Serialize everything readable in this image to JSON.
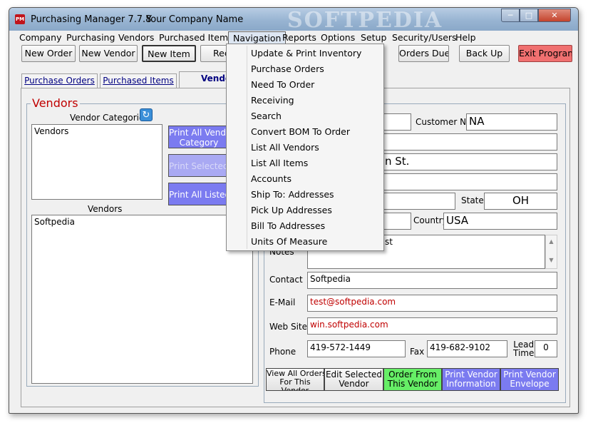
{
  "window": {
    "title": "Purchasing Manager 7.7.8",
    "company": "Your Company Name",
    "watermark": "SOFTPEDIA",
    "app_icon_text": "PM"
  },
  "menubar": [
    "Company",
    "Purchasing",
    "Vendors",
    "Purchased Items",
    "Navigation",
    "Reports",
    "Options",
    "Setup",
    "Security/Users",
    "Help"
  ],
  "toolbar": {
    "new_order": "New Order",
    "new_vendor": "New Vendor",
    "new_item": "New Item",
    "rec_partial": "Rec",
    "orders_due": "Orders Due",
    "back_up": "Back Up",
    "exit": "Exit Program"
  },
  "tabs": {
    "purchase_orders": "Purchase Orders",
    "purchased_items": "Purchased Items",
    "vendors": "Vendo"
  },
  "left": {
    "heading": "Vendors",
    "categories_label": "Vendor Categories",
    "categories": [
      "Vendors"
    ],
    "vendors_label": "Vendors",
    "vendors": [
      "Softpedia"
    ],
    "btn_print_all_category": "Print All Vendor\nCategory",
    "btn_print_selected": "Print Selected C",
    "btn_print_all_listed": "Print All Listed V"
  },
  "form": {
    "customer_no_label": "Customer No.",
    "customer_no": "NA",
    "address_partial": "n St.",
    "state_label": "State",
    "state": "OH",
    "country_label": "Country",
    "country": "USA",
    "notes_label": "Notes",
    "notes_partial": "st",
    "contact_label": "Contact",
    "contact": "Softpedia",
    "email_label": "E-Mail",
    "email": "test@softpedia.com",
    "website_label": "Web Site",
    "website": "win.softpedia.com",
    "phone_label": "Phone",
    "phone": "419-572-1449",
    "fax_label": "Fax",
    "fax": "419-682-9102",
    "lead_time_label": "Lead\nTime",
    "lead_time": "0"
  },
  "bottom_buttons": {
    "view_all_orders": "View All Orders\nFor This\nVendor",
    "edit_selected": "Edit Selected\nVendor",
    "order_from": "Order From\nThis Vendor",
    "print_info": "Print Vendor\nInformation",
    "print_envelope": "Print Vendor\nEnvelope"
  },
  "navigation_menu": [
    "Update & Print Inventory",
    "Purchase Orders",
    "Need To Order",
    "Receiving",
    "Search",
    "Convert BOM To Order",
    "List All Vendors",
    "List All Items",
    "Accounts",
    "Ship To: Addresses",
    "Pick Up Addresses",
    "Bill To Addresses",
    "Units Of Measure"
  ],
  "colors": {
    "vendor_button": "#7b7bf0",
    "order_from_button": "#66ee66",
    "exit_button": "#f07070",
    "email_text": "#c00000"
  }
}
